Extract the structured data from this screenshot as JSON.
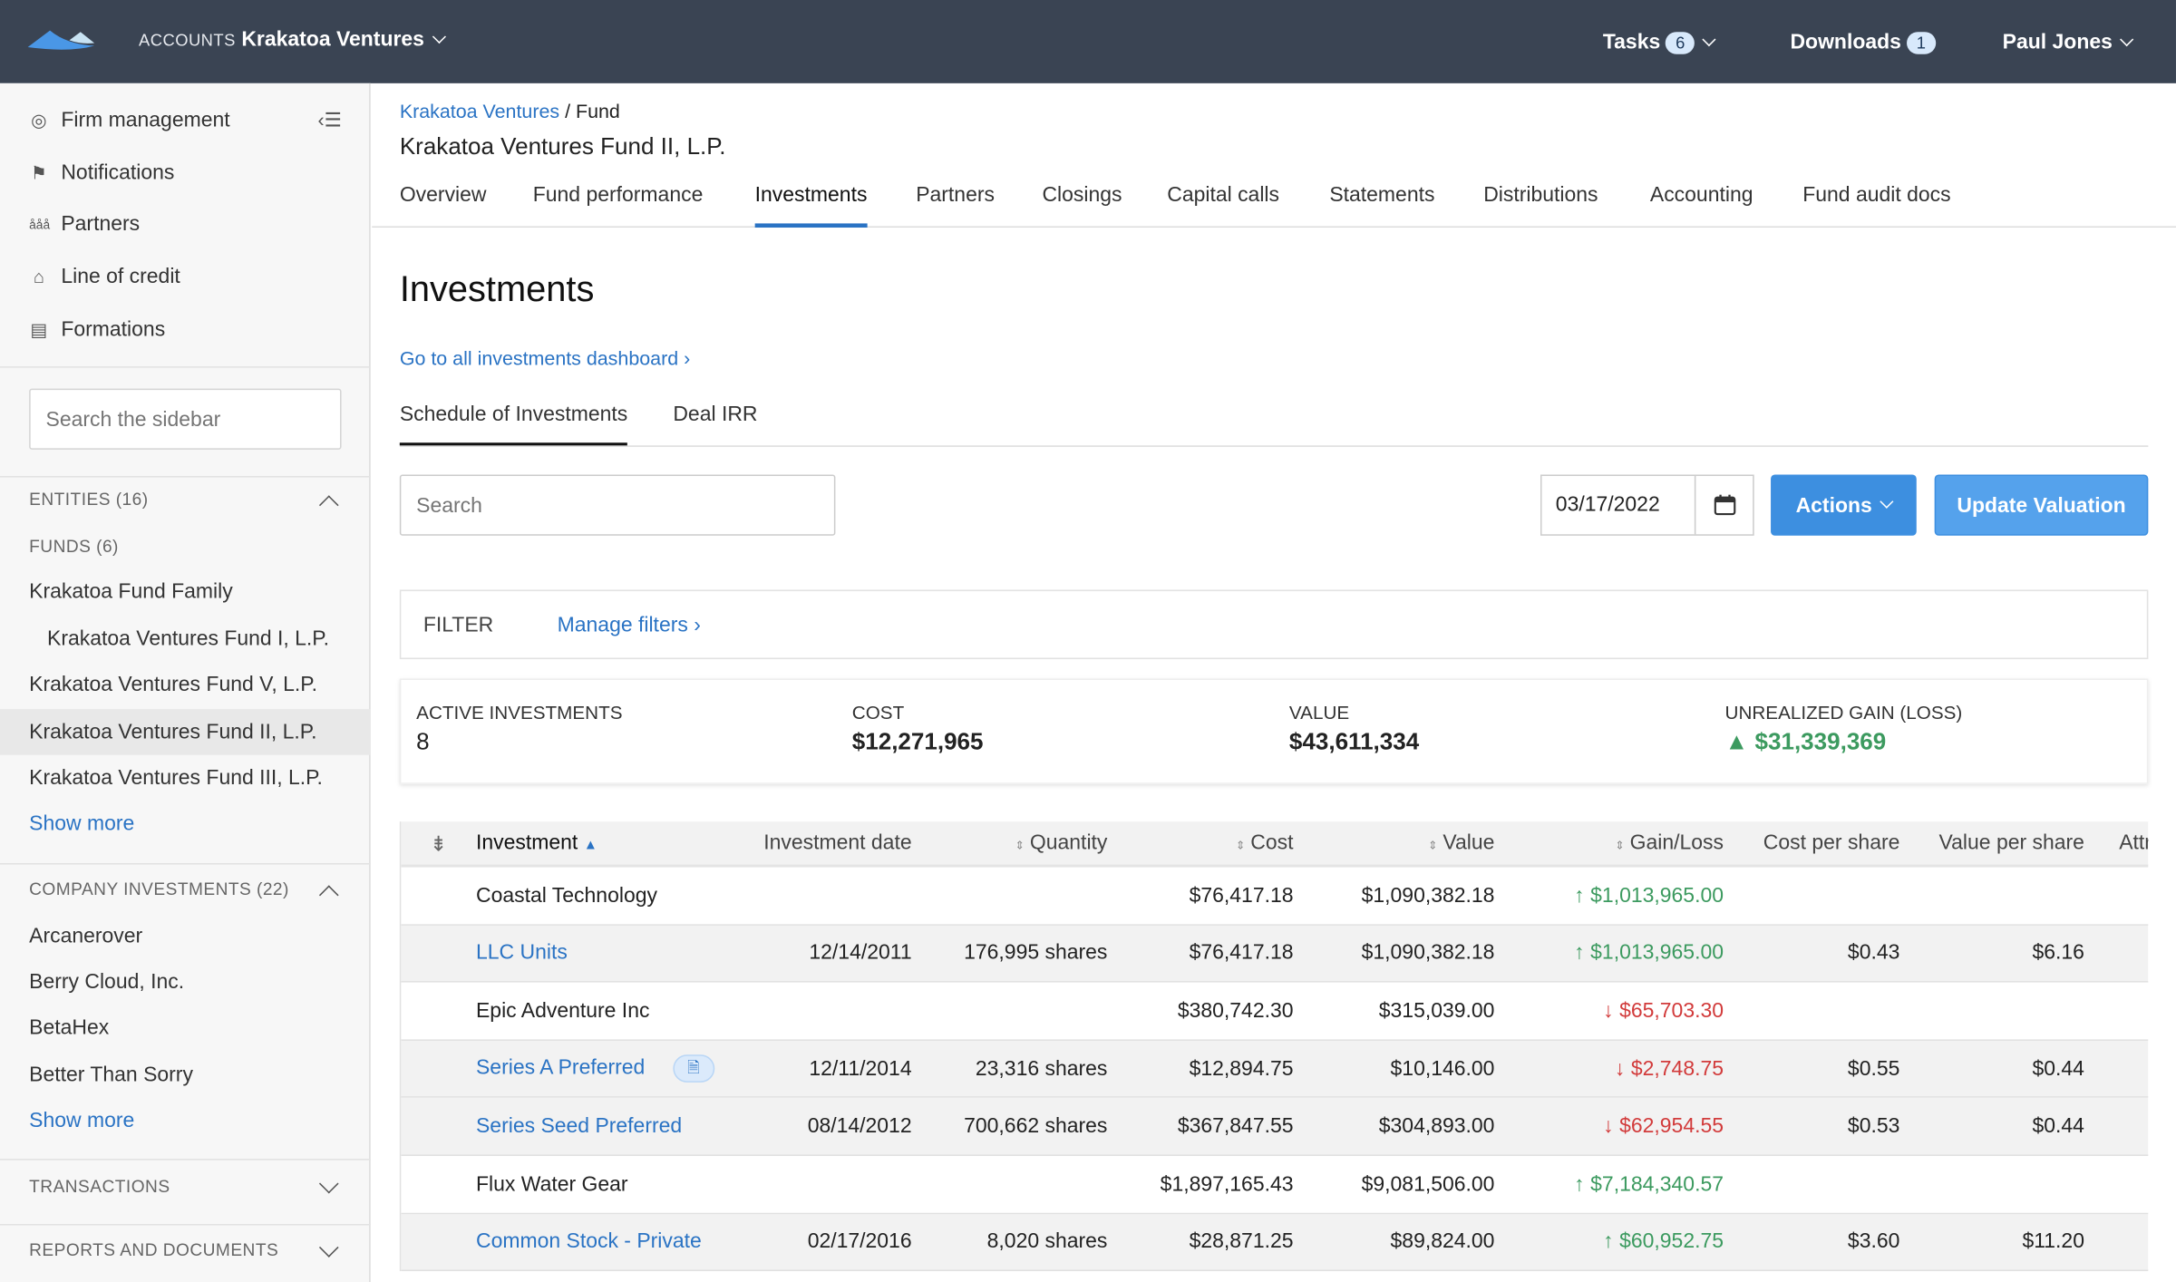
{
  "topbar": {
    "accounts_label": "ACCOUNTS",
    "account_name": "Krakatoa Ventures",
    "tasks_label": "Tasks",
    "tasks_count": "6",
    "downloads_label": "Downloads",
    "downloads_count": "1",
    "user": "Paul Jones"
  },
  "sidebar": {
    "nav": [
      {
        "label": "Firm management",
        "icon": "globe-icon"
      },
      {
        "label": "Notifications",
        "icon": "flag-icon"
      },
      {
        "label": "Partners",
        "icon": "people-icon"
      },
      {
        "label": "Line of credit",
        "icon": "bank-icon"
      },
      {
        "label": "Formations",
        "icon": "document-icon"
      }
    ],
    "search_placeholder": "Search the sidebar",
    "entities_label": "ENTITIES (16)",
    "funds_label": "FUNDS (6)",
    "funds": [
      "Krakatoa Fund Family",
      "Krakatoa Ventures Fund I, L.P.",
      "Krakatoa Ventures Fund V, L.P.",
      "Krakatoa Ventures Fund II, L.P.",
      "Krakatoa Ventures Fund III, L.P."
    ],
    "show_more": "Show more",
    "company_label": "COMPANY INVESTMENTS (22)",
    "companies": [
      "Arcanerover",
      "Berry Cloud, Inc.",
      "BetaHex",
      "Better Than Sorry"
    ],
    "transactions_label": "TRANSACTIONS",
    "reports_label": "REPORTS AND DOCUMENTS"
  },
  "main": {
    "breadcrumb_link": "Krakatoa Ventures",
    "breadcrumb_current": "/ Fund",
    "fund_title": "Krakatoa Ventures Fund II, L.P.",
    "tabs": [
      "Overview",
      "Fund performance",
      "Investments",
      "Partners",
      "Closings",
      "Capital calls",
      "Statements",
      "Distributions",
      "Accounting",
      "Fund audit docs"
    ],
    "page_title": "Investments",
    "dashboard_link": "Go to all investments dashboard ›",
    "subtabs": [
      "Schedule of Investments",
      "Deal IRR"
    ],
    "search_placeholder": "Search",
    "date": "03/17/2022",
    "actions_label": "Actions",
    "update_label": "Update Valuation",
    "filter_label": "FILTER",
    "manage_filters": "Manage filters ›",
    "stats": [
      {
        "label": "ACTIVE INVESTMENTS",
        "value": "8"
      },
      {
        "label": "COST",
        "value": "$12,271,965"
      },
      {
        "label": "VALUE",
        "value": "$43,611,334"
      },
      {
        "label": "UNREALIZED GAIN (LOSS)",
        "value": "$31,339,369"
      }
    ],
    "colors": {
      "accent": "#2a73c4",
      "gain": "#3c9a5f",
      "loss": "#d23b3b",
      "topbar": "#3a4453"
    }
  },
  "table": {
    "headers": [
      "Investment",
      "Investment date",
      "Quantity",
      "Cost",
      "Value",
      "Gain/Loss",
      "Cost per share",
      "Value per share",
      "Attr"
    ],
    "rows": [
      {
        "type": "group",
        "name": "Coastal Technology",
        "date": "",
        "qty": "",
        "cost": "$76,417.18",
        "value": "$1,090,382.18",
        "gain": "$1,013,965.00",
        "dir": "up",
        "cps": "",
        "vps": ""
      },
      {
        "type": "sub",
        "name": "LLC Units",
        "date": "12/14/2011",
        "qty": "176,995 shares",
        "cost": "$76,417.18",
        "value": "$1,090,382.18",
        "gain": "$1,013,965.00",
        "dir": "up",
        "cps": "$0.43",
        "vps": "$6.16"
      },
      {
        "type": "group",
        "name": "Epic Adventure Inc",
        "date": "",
        "qty": "",
        "cost": "$380,742.30",
        "value": "$315,039.00",
        "gain": "$65,703.30",
        "dir": "down",
        "cps": "",
        "vps": ""
      },
      {
        "type": "sub",
        "name": "Series A Preferred",
        "doc": true,
        "date": "12/11/2014",
        "qty": "23,316 shares",
        "cost": "$12,894.75",
        "value": "$10,146.00",
        "gain": "$2,748.75",
        "dir": "down",
        "cps": "$0.55",
        "vps": "$0.44"
      },
      {
        "type": "sub",
        "name": "Series Seed Preferred",
        "date": "08/14/2012",
        "qty": "700,662 shares",
        "cost": "$367,847.55",
        "value": "$304,893.00",
        "gain": "$62,954.55",
        "dir": "down",
        "cps": "$0.53",
        "vps": "$0.44"
      },
      {
        "type": "group",
        "name": "Flux Water Gear",
        "date": "",
        "qty": "",
        "cost": "$1,897,165.43",
        "value": "$9,081,506.00",
        "gain": "$7,184,340.57",
        "dir": "up",
        "cps": "",
        "vps": ""
      },
      {
        "type": "sub",
        "name": "Common Stock - Private",
        "date": "02/17/2016",
        "qty": "8,020 shares",
        "cost": "$28,871.25",
        "value": "$89,824.00",
        "gain": "$60,952.75",
        "dir": "up",
        "cps": "$3.60",
        "vps": "$11.20"
      }
    ]
  }
}
